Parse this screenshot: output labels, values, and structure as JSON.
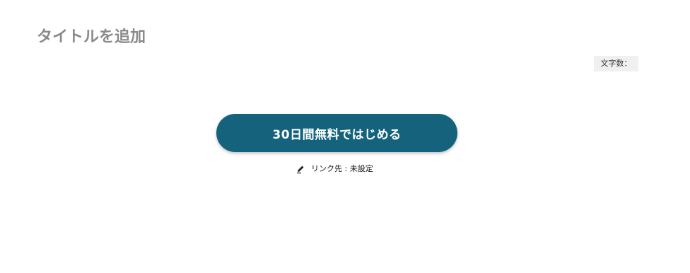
{
  "title": {
    "placeholder": "タイトルを追加",
    "value": ""
  },
  "char_count": {
    "label": "文字数："
  },
  "cta": {
    "label": "30日間無料ではじめる",
    "color": "#14627c"
  },
  "link": {
    "icon": "pencil-icon",
    "label": "リンク先 : 未設定"
  }
}
